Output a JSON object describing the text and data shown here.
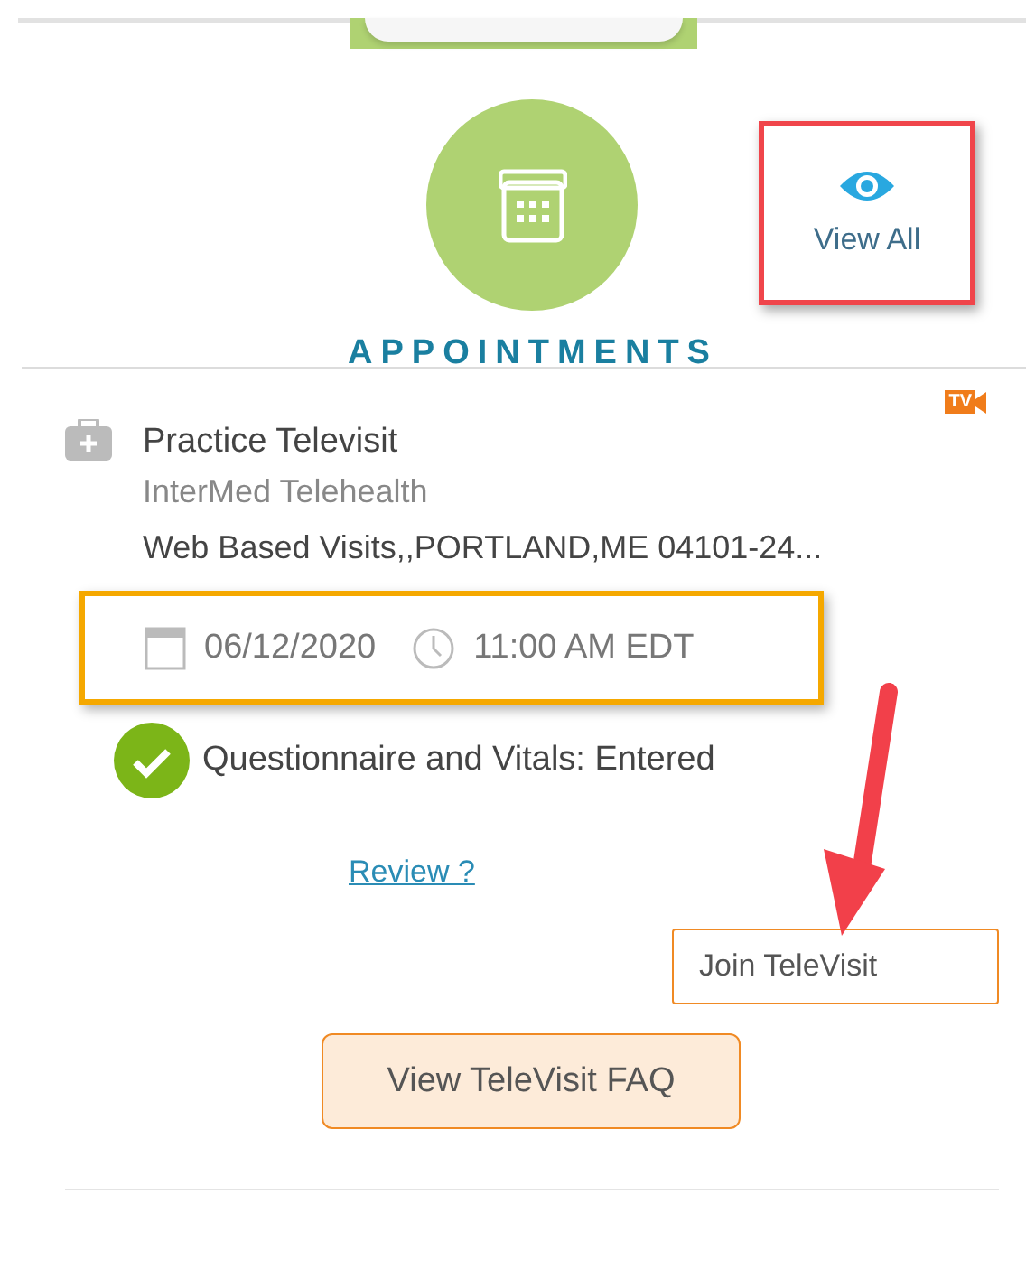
{
  "header": {
    "title": "APPOINTMENTS",
    "view_all": "View All"
  },
  "appointment": {
    "badge": "TV",
    "title": "Practice Televisit",
    "provider": "InterMed Telehealth",
    "address": "Web Based Visits,,PORTLAND,ME 04101-24...",
    "date": "06/12/2020",
    "time": "11:00 AM EDT",
    "status": {
      "text": "Questionnaire and Vitals: Entered",
      "complete": true
    },
    "review_link": "Review ?",
    "join_button": "Join TeleVisit",
    "faq_button": "View TeleVisit FAQ"
  }
}
